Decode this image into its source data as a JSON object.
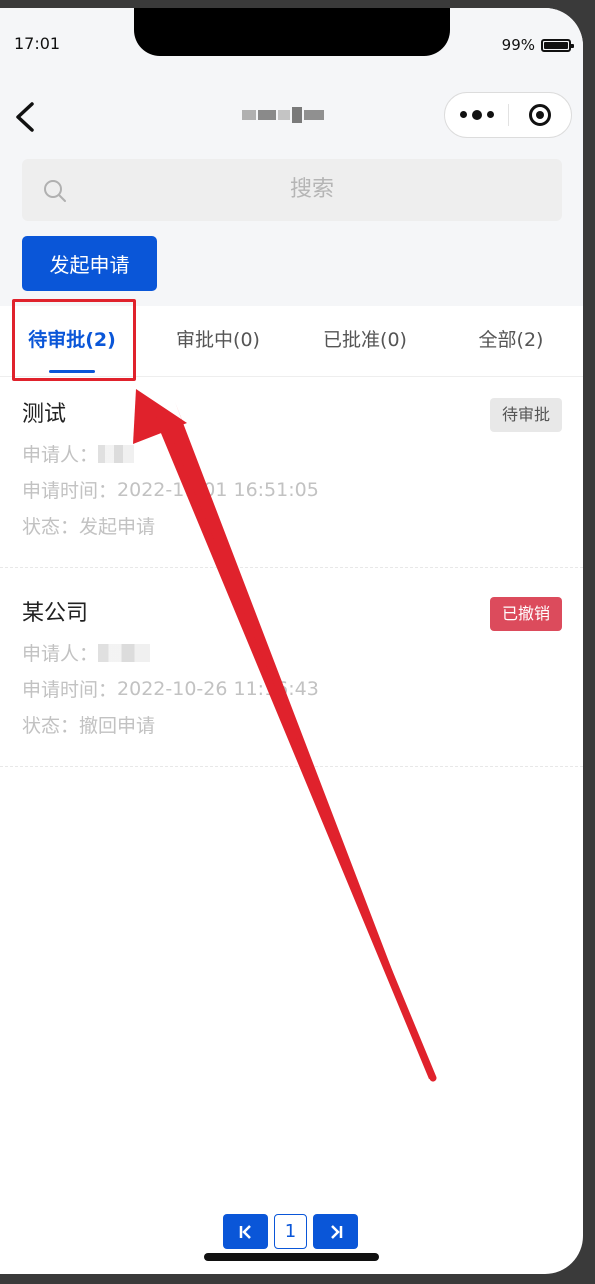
{
  "status_bar": {
    "time": "17:01",
    "battery": "99%"
  },
  "nav": {
    "title_obscured": true
  },
  "search": {
    "placeholder": "搜索"
  },
  "apply_button": {
    "label": "发起申请"
  },
  "tabs": [
    {
      "label": "待审批(2)",
      "active": true
    },
    {
      "label": "审批中(0)",
      "active": false
    },
    {
      "label": "已批准(0)",
      "active": false
    },
    {
      "label": "全部(2)",
      "active": false
    }
  ],
  "records": [
    {
      "title": "测试",
      "badge": "待审批",
      "applicant_label": "申请人：",
      "time_label": "申请时间：",
      "time_value": "2022-11-01 16:51:05",
      "status_label": "状态：",
      "status_value": "发起申请"
    },
    {
      "title": "某公司",
      "badge": "已撤销",
      "applicant_label": "申请人：",
      "time_label": "申请时间：",
      "time_value": "2022-10-26 11:16:43",
      "status_label": "状态：",
      "status_value": "撤回申请"
    }
  ],
  "pagination": {
    "first_icon": "K",
    "page": "1",
    "last_icon": "K"
  },
  "colors": {
    "primary": "#0a56d8",
    "revoked": "#dc4b5c",
    "annotation": "#e0222c"
  }
}
